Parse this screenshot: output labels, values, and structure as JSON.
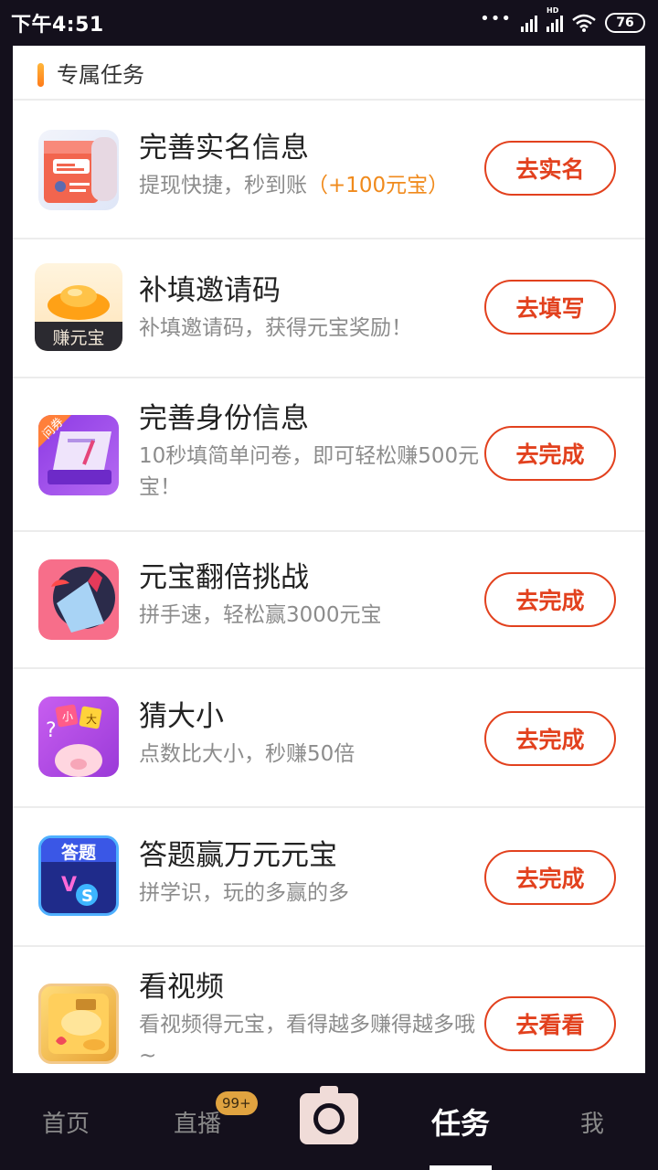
{
  "status_bar": {
    "time": "下午4:51",
    "hd": "HD",
    "battery": "76"
  },
  "section": {
    "title": "专属任务"
  },
  "tasks": [
    {
      "title": "完善实名信息",
      "desc": "提现快捷，秒到账",
      "bonus": "（+100元宝）",
      "button": "去实名",
      "icon": "id-card-icon"
    },
    {
      "title": "补填邀请码",
      "desc": "补填邀请码，获得元宝奖励！",
      "bonus": "",
      "button": "去填写",
      "icon": "gold-ingot-icon",
      "icon_caption": "赚元宝"
    },
    {
      "title": "完善身份信息",
      "desc": "10秒填简单问卷，即可轻松赚500元宝！",
      "bonus": "",
      "button": "去完成",
      "icon": "questionnaire-icon",
      "icon_caption": "问券"
    },
    {
      "title": "元宝翻倍挑战",
      "desc": "拼手速，轻松赢3000元宝",
      "bonus": "",
      "button": "去完成",
      "icon": "fruit-slice-icon"
    },
    {
      "title": "猜大小",
      "desc": "点数比大小，秒赚50倍",
      "bonus": "",
      "button": "去完成",
      "icon": "pig-dice-icon",
      "icon_caption_left": "小",
      "icon_caption_right": "大"
    },
    {
      "title": "答题赢万元元宝",
      "desc": "拼学识，玩的多赢的多",
      "bonus": "",
      "button": "去完成",
      "icon": "quiz-vs-icon",
      "icon_caption": "答题"
    },
    {
      "title": "看视频",
      "desc": "看视频得元宝，看得越多赚得越多哦~",
      "bonus": "",
      "button": "去看看",
      "icon": "video-reward-icon"
    }
  ],
  "nav": {
    "home": "首页",
    "live": "直播",
    "live_badge": "99+",
    "tasks": "任务",
    "me": "我"
  },
  "colors": {
    "accent": "#e2411e",
    "bonus": "#f08a1c",
    "background": "#14101c"
  }
}
